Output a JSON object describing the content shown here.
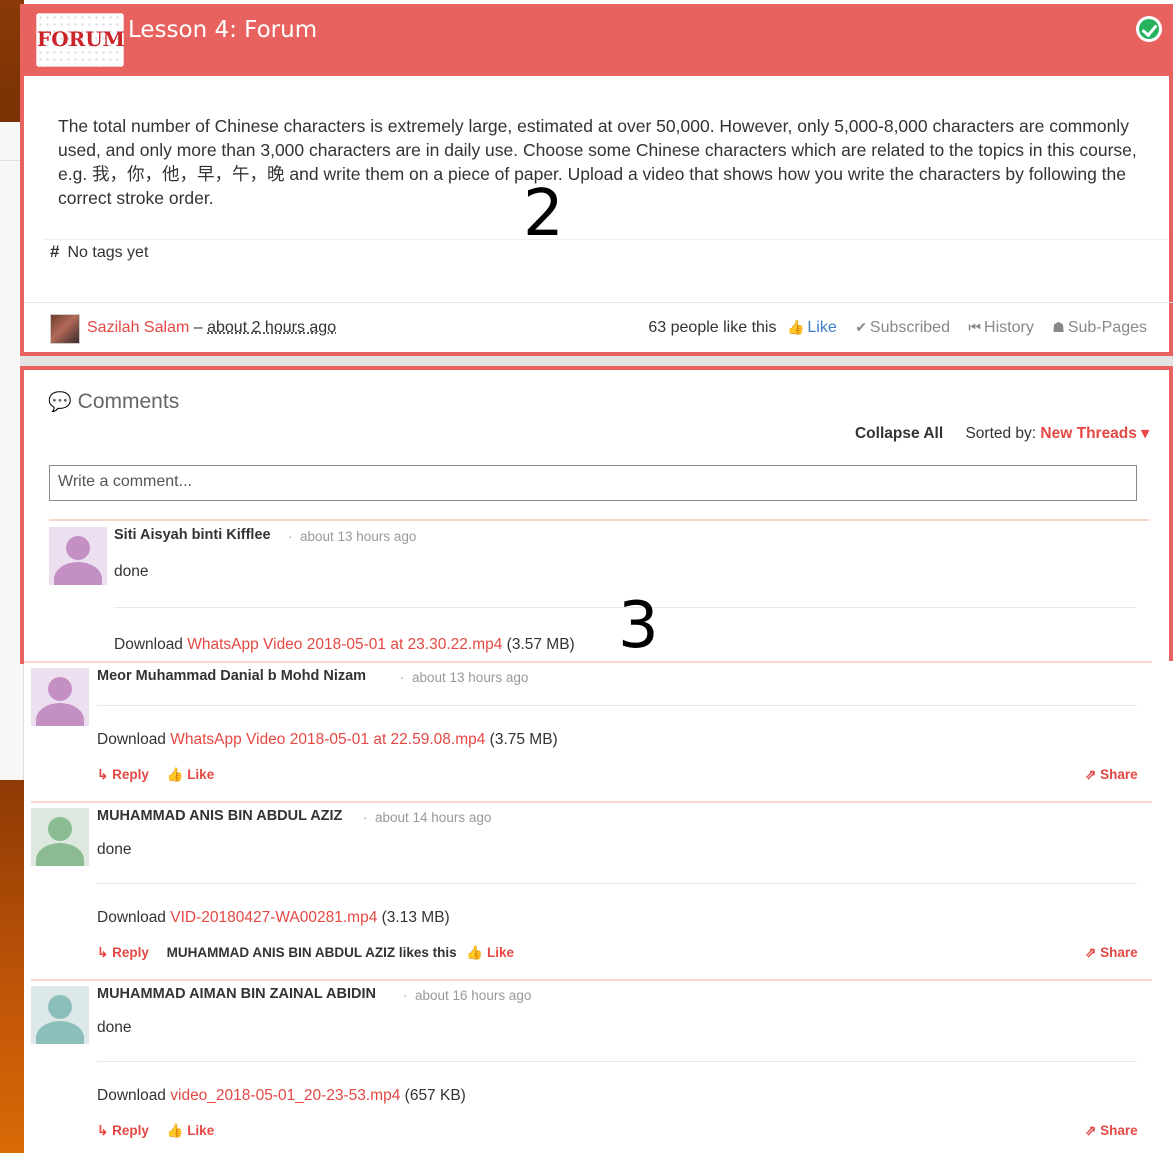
{
  "lesson": {
    "logo_text": "FORUM",
    "title": "Lesson 4: Forum",
    "body": "The total number of Chinese characters is extremely large, estimated at over 50,000. However, only 5,000-8,000 characters are commonly used, and only more than 3,000 characters are in daily use. Choose some Chinese characters which are related to the topics in this course, e.g. 我，你，他，早，午，晚 and write them on a piece of paper. Upload a video that shows how you write the characters by following the correct stroke order.",
    "tags_label": "No tags yet",
    "author": "Sazilah Salam",
    "dash": "–",
    "posted_time": "about 2 hours ago",
    "likes_text": "63 people like this",
    "like_label": "Like",
    "subscribed_label": "Subscribed",
    "history_label": "History",
    "subpages_label": "Sub-Pages"
  },
  "comments_section": {
    "heading": "Comments",
    "collapse_label": "Collapse All",
    "sorted_by_label": "Sorted by:",
    "sort_value": "New Threads",
    "input_placeholder": "Write a comment..."
  },
  "comments": [
    {
      "name": "Siti Aisyah binti Kifflee",
      "time": "about 13 hours ago",
      "text": "done",
      "download_label": "Download",
      "file": "WhatsApp Video 2018-05-01 at 23.30.22.mp4",
      "size": "(3.57 MB)"
    },
    {
      "name": "Meor Muhammad Danial b Mohd Nizam",
      "time": "about 13 hours ago",
      "download_label": "Download",
      "file": "WhatsApp Video 2018-05-01 at 22.59.08.mp4",
      "size": "(3.75 MB)",
      "reply_label": "Reply",
      "like_label": "Like",
      "share_label": "Share"
    },
    {
      "name": "MUHAMMAD ANIS BIN ABDUL AZIZ",
      "time": "about 14 hours ago",
      "text": "done",
      "download_label": "Download",
      "file": "VID-20180427-WA00281.mp4",
      "size": "(3.13 MB)",
      "reply_label": "Reply",
      "likers_text": "MUHAMMAD ANIS BIN ABDUL AZIZ likes this",
      "like_label": "Like",
      "share_label": "Share"
    },
    {
      "name": "MUHAMMAD AIMAN BIN ZAINAL ABIDIN",
      "time": "about 16 hours ago",
      "text": "done",
      "download_label": "Download",
      "file": "video_2018-05-01_20-23-53.mp4",
      "size": "(657 KB)",
      "reply_label": "Reply",
      "like_label": "Like",
      "share_label": "Share"
    }
  ],
  "annotations": {
    "first": "2",
    "second": "3"
  },
  "colors": {
    "brand_red": "#e8635f",
    "link_red": "#e54843",
    "like_blue": "#3b7cc4",
    "bg_orange": "#c25608"
  },
  "icons": [
    "check-circle-icon",
    "hash-icon",
    "thumbs-up-icon",
    "check-icon",
    "history-icon",
    "sitemap-icon",
    "comments-icon",
    "caret-down-icon",
    "reply-icon",
    "like-icon",
    "share-icon"
  ]
}
